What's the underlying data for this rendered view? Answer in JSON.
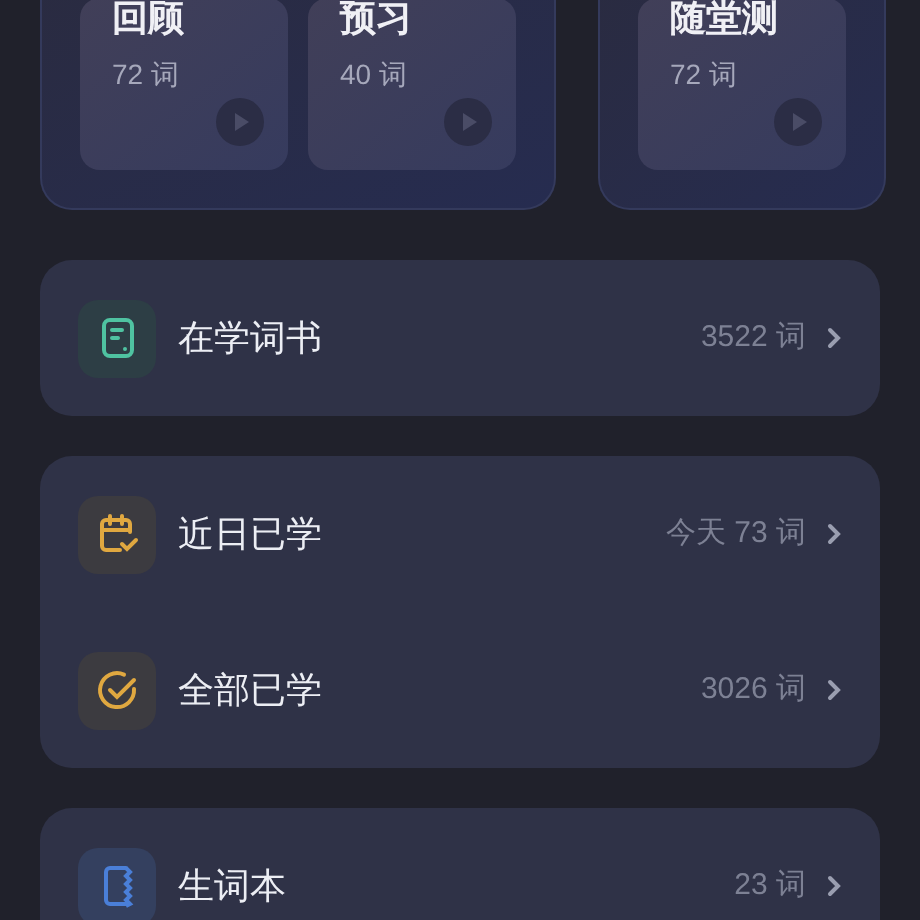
{
  "practice_panels": [
    {
      "cards": [
        {
          "title": "回顾",
          "count": "72 词"
        },
        {
          "title": "预习",
          "count": "40 词"
        }
      ]
    },
    {
      "cards": [
        {
          "title": "随堂测",
          "count": "72 词"
        }
      ]
    }
  ],
  "groups": [
    {
      "rows": [
        {
          "kind": "book",
          "label": "在学词书",
          "value": "3522 词"
        }
      ]
    },
    {
      "rows": [
        {
          "kind": "calendar",
          "label": "近日已学",
          "value": "今天 73 词"
        },
        {
          "kind": "check",
          "label": "全部已学",
          "value": "3026 词"
        }
      ]
    },
    {
      "rows": [
        {
          "kind": "notebook",
          "label": "生词本",
          "value": "23 词"
        }
      ]
    }
  ]
}
